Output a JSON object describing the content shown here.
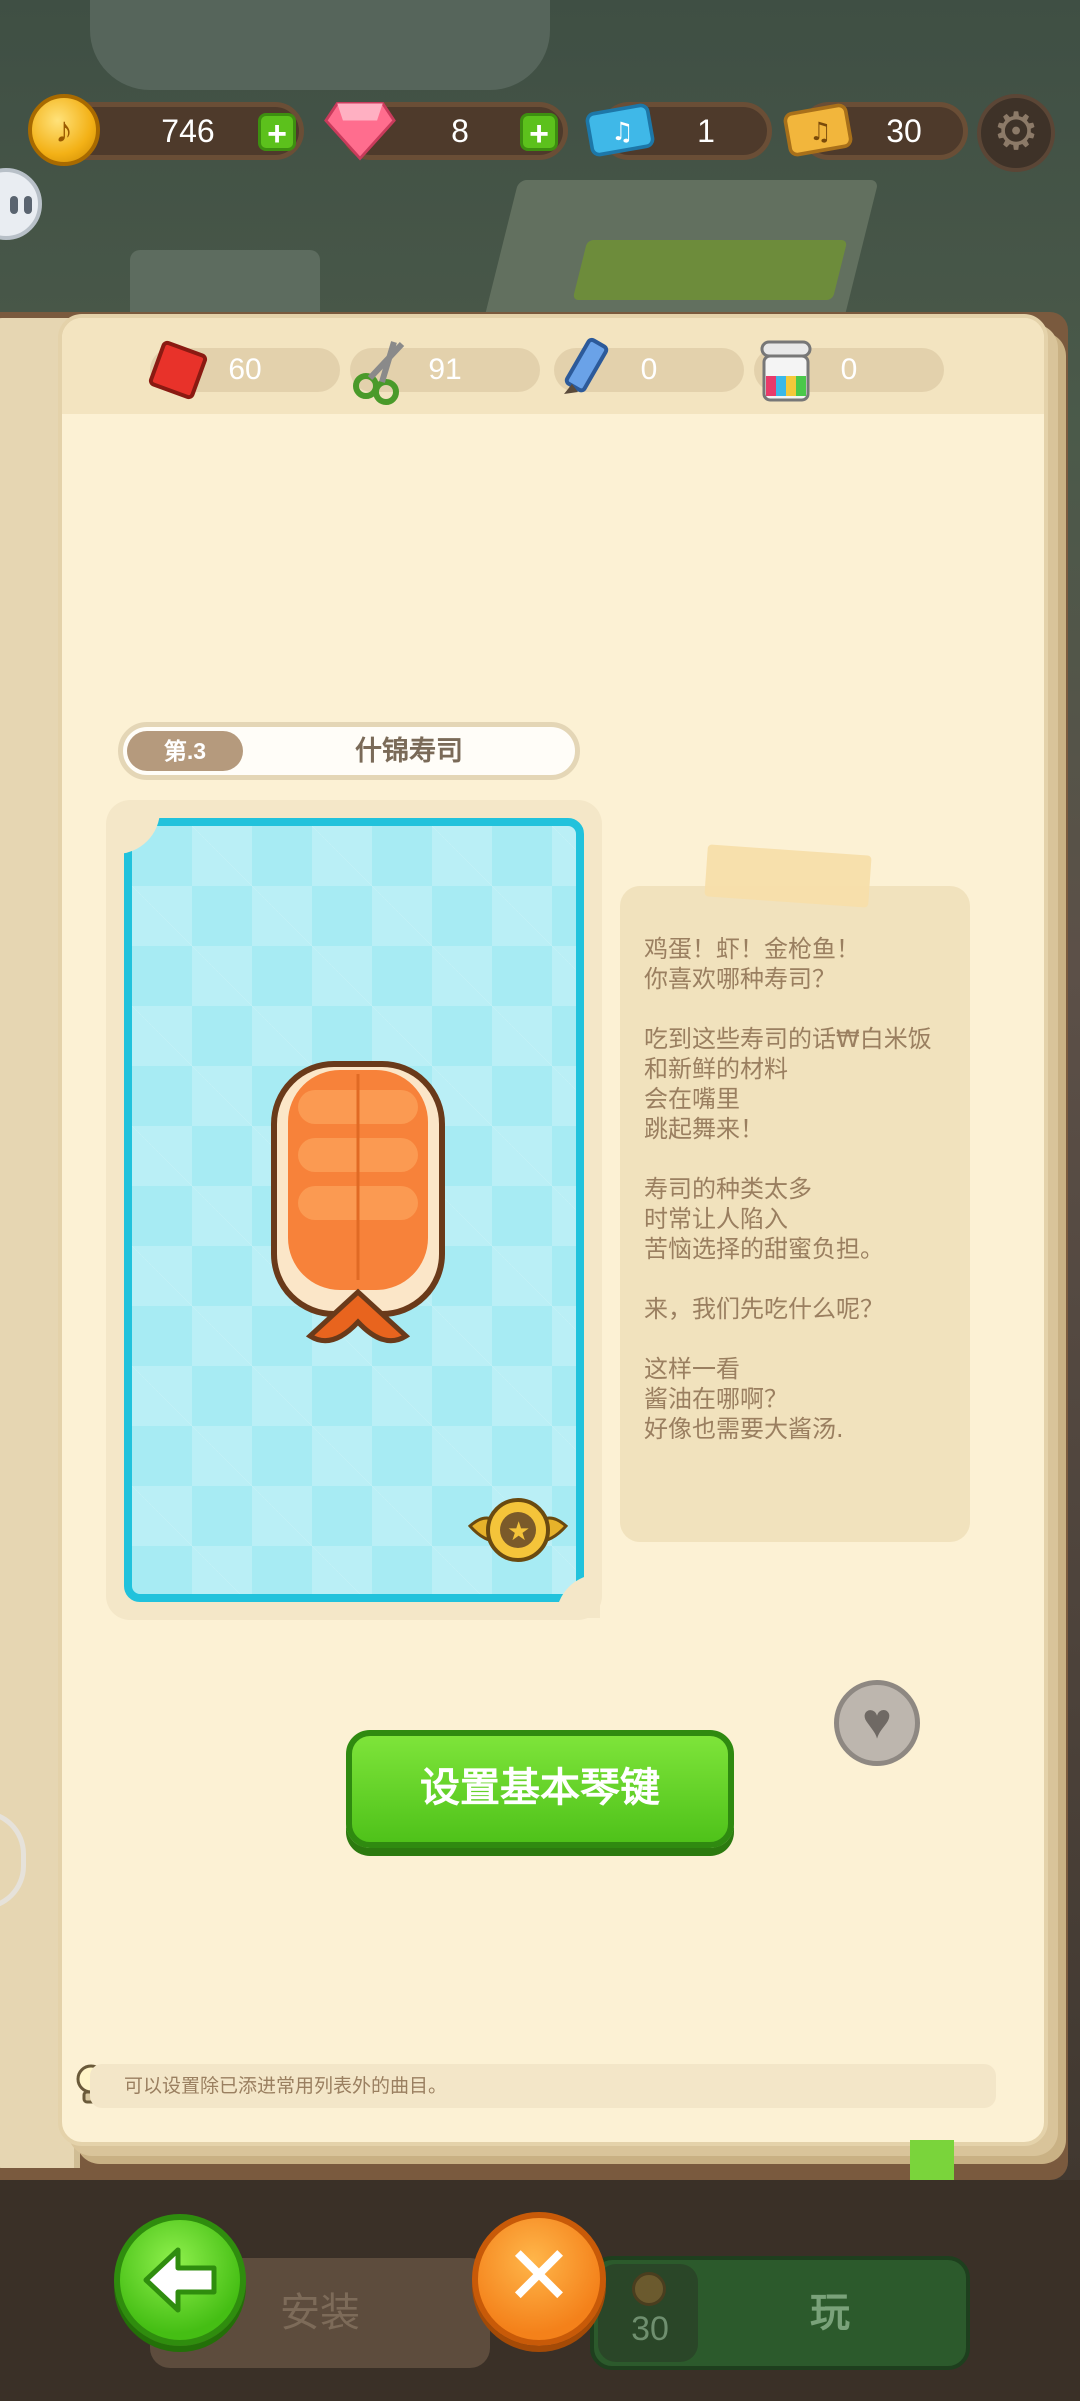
{
  "currency": {
    "coins": "746",
    "gems": "8",
    "tickets": "1",
    "gold_tickets": "30"
  },
  "resources": [
    {
      "name": "red-paper",
      "value": "60"
    },
    {
      "name": "scissors",
      "value": "91"
    },
    {
      "name": "pencil",
      "value": "0"
    },
    {
      "name": "paint-jar",
      "value": "0"
    }
  ],
  "stage": {
    "tag": "第.3",
    "title": "什锦寿司"
  },
  "description": {
    "p1": "鸡蛋！虾！金枪鱼！\n你喜欢哪种寿司？",
    "p2": "吃到这些寿司的话₩白米饭\n和新鲜的材料\n会在嘴里\n跳起舞来！",
    "p3": "寿司的种类太多\n时常让人陷入\n苦恼选择的甜蜜负担。",
    "p4": "来，我们先吃什么呢？",
    "p5": "这样一看\n酱油在哪啊？\n好像也需要大酱汤."
  },
  "main_button": "设置基本琴键",
  "hint": "可以设置除已添进常用列表外的曲目。",
  "bottom": {
    "install": "安装",
    "play_cost": "30",
    "play": "玩"
  },
  "colors": {
    "card_border": "#21c2dc",
    "main_button": "#4fc21a",
    "close_button": "#f4811a"
  }
}
